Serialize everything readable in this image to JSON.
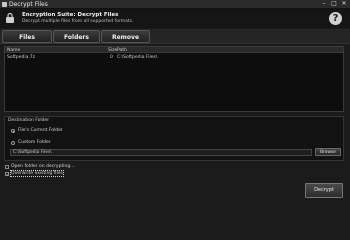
{
  "window": {
    "title": "Decrypt Files"
  },
  "header": {
    "title": "Encryption Suite: Decrypt Files",
    "subtitle": "Decrypt multiple files from all supported formats.",
    "help_label": "?"
  },
  "tabs": [
    {
      "label": "Files"
    },
    {
      "label": "Folders"
    },
    {
      "label": "Remove"
    }
  ],
  "file_list": {
    "columns": [
      "Name",
      "Size",
      "Path"
    ],
    "rows": [
      {
        "name": "Softpedia.7z",
        "size": "0",
        "path": "C:\\Softpedia Files\\"
      }
    ]
  },
  "destination": {
    "label": "Destination Folder",
    "options": [
      {
        "label": "File's Current Folder",
        "selected": true
      },
      {
        "label": "Custom Folder",
        "selected": false
      }
    ],
    "custom_path": "C:\\Softpedia Files\\",
    "browse_label": "Browse"
  },
  "options": [
    {
      "label": "Open folder on decrypting...",
      "checked": false
    },
    {
      "label": "Overwrite existing files",
      "checked": true
    }
  ],
  "actions": {
    "decrypt_label": "Decrypt"
  },
  "colors": {
    "background": "#1b1b1b",
    "panel": "#0d0d0d",
    "text": "#d8d8d8"
  }
}
